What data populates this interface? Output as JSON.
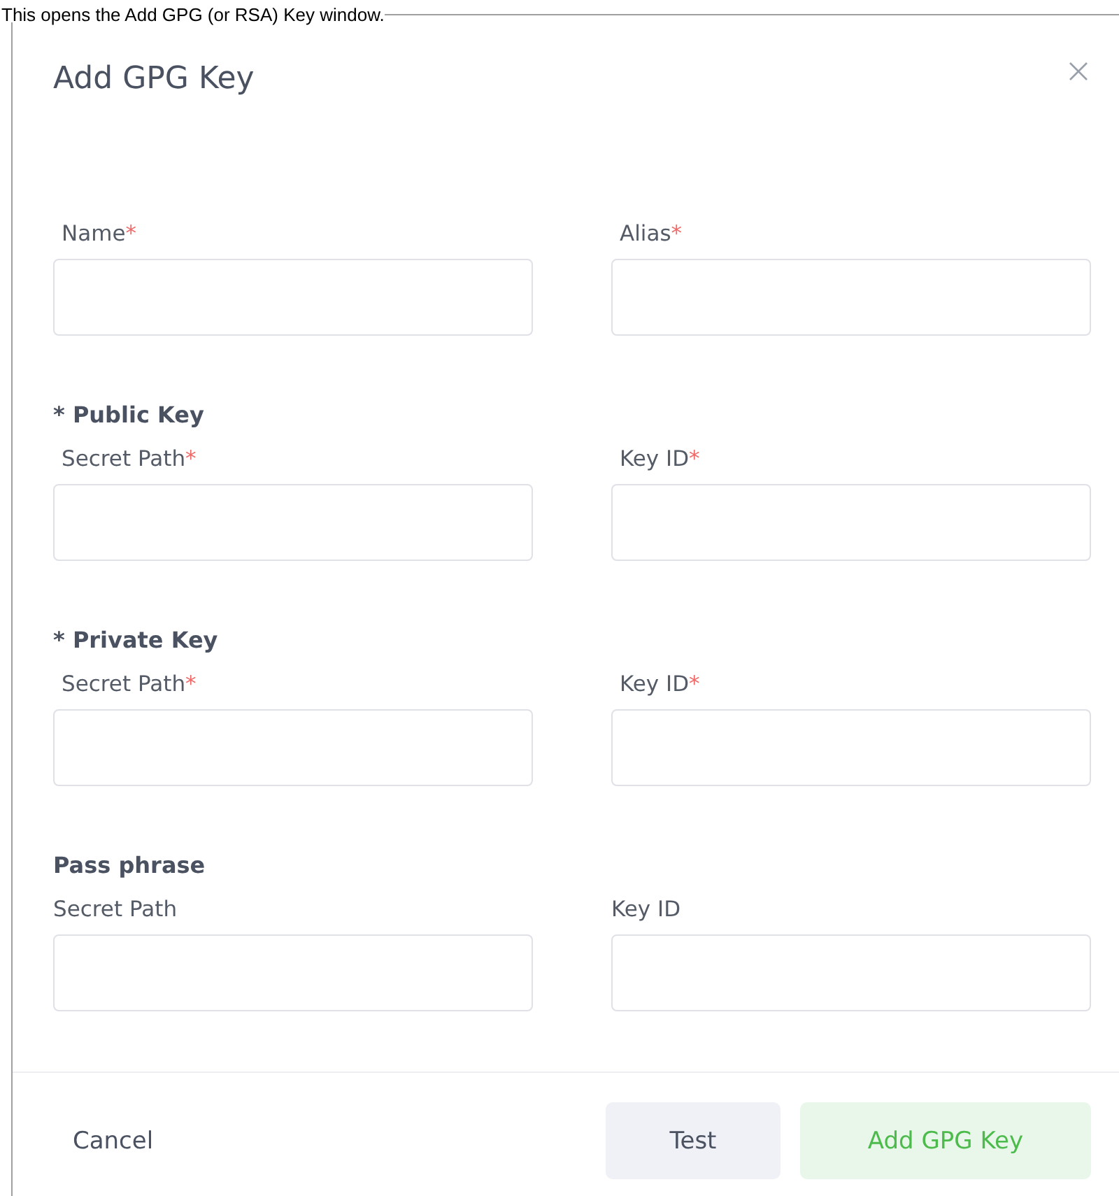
{
  "caption": "This opens the Add GPG (or RSA) Key window.",
  "dialog": {
    "title": "Add GPG Key",
    "sections": [
      {
        "fields": [
          {
            "label": "Name",
            "required_mark": "*"
          },
          {
            "label": "Alias",
            "required_mark": "*"
          }
        ]
      },
      {
        "heading": "* Public Key",
        "fields": [
          {
            "label": "Secret Path",
            "required_mark": "*"
          },
          {
            "label": "Key ID",
            "required_mark": "*"
          }
        ]
      },
      {
        "heading": "* Private Key",
        "fields": [
          {
            "label": "Secret Path",
            "required_mark": "*"
          },
          {
            "label": "Key ID",
            "required_mark": "*"
          }
        ]
      },
      {
        "heading": "Pass phrase",
        "fields": [
          {
            "label": "Secret Path"
          },
          {
            "label": "Key ID"
          }
        ]
      }
    ],
    "buttons": [
      {
        "label": "Cancel",
        "kind": "plain"
      },
      {
        "label": "Test",
        "kind": "secondary"
      },
      {
        "label": "Add GPG Key",
        "kind": "primary"
      }
    ]
  }
}
